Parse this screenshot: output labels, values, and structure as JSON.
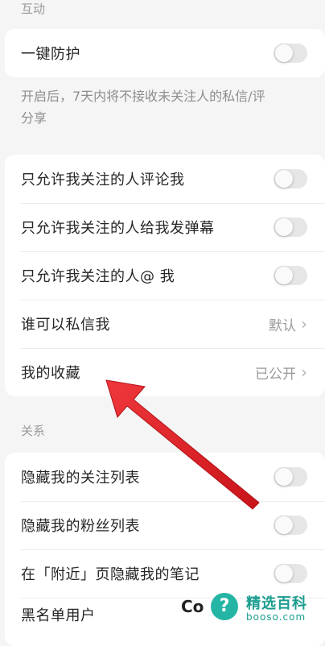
{
  "sections": {
    "interaction_label": "互动",
    "relation_label": "关系"
  },
  "protection": {
    "label": "一键防护",
    "note_line1": "开启后，7天内将不接收未关注人的私信/评",
    "note_line2": "分享"
  },
  "interaction_rows": [
    {
      "label": "只允许我关注的人评论我",
      "type": "toggle",
      "on": false
    },
    {
      "label": "只允许我关注的人给我发弹幕",
      "type": "toggle",
      "on": false
    },
    {
      "label": "只允许我关注的人@ 我",
      "type": "toggle",
      "on": false
    },
    {
      "label": "谁可以私信我",
      "type": "value",
      "value": "默认"
    },
    {
      "label": "我的收藏",
      "type": "value",
      "value": "已公开"
    }
  ],
  "relation_rows": [
    {
      "label": "隐藏我的关注列表",
      "type": "toggle",
      "on": false
    },
    {
      "label": "隐藏我的粉丝列表",
      "type": "toggle",
      "on": false
    },
    {
      "label": "在「附近」页隐藏我的笔记",
      "type": "toggle",
      "on": false
    },
    {
      "label": "黑名单用户",
      "type": "link"
    }
  ],
  "watermark": {
    "prefix": "Co",
    "logo_glyph": "?",
    "title": "精选百科",
    "subtitle": "booso.com"
  },
  "colors": {
    "background": "#f5f5f5",
    "card": "#ffffff",
    "arrow": "#e8262b",
    "toggle_off": "#e6e6e6",
    "watermark": "#1a9d8f"
  }
}
